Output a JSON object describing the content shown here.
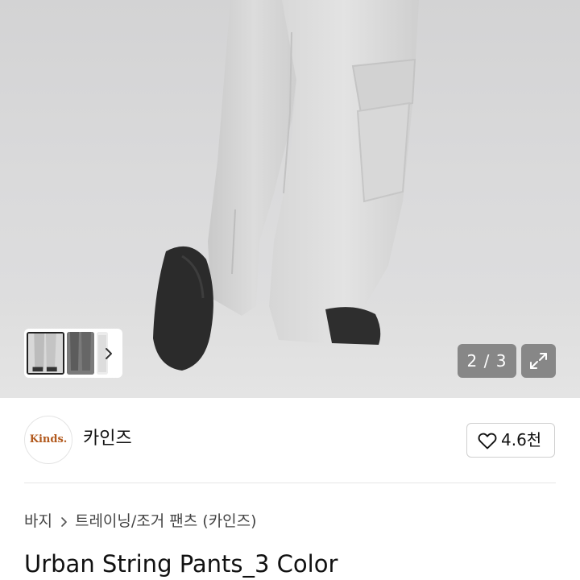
{
  "gallery": {
    "counter_current": "2",
    "counter_total": "3",
    "counter_separator": "/",
    "counter_text": "2 / 3",
    "thumbnails": [
      {
        "name": "thumb-1",
        "selected": true
      },
      {
        "name": "thumb-2",
        "selected": false
      },
      {
        "name": "thumb-3",
        "selected": false
      }
    ],
    "next_icon": "chevron-right-icon",
    "expand_icon": "expand-arrows-icon"
  },
  "seller": {
    "logo_text": "Kinds.",
    "name": "카인즈",
    "like_icon": "heart-outline-icon",
    "like_count": "4.6천"
  },
  "breadcrumb": {
    "items": [
      "바지",
      "트레이닝/조거 팬츠 (카인즈)"
    ],
    "separator_icon": "chevron-right-icon"
  },
  "product": {
    "title": "Urban String Pants_3 Color"
  },
  "colors": {
    "logo_text": "#b25a1e",
    "counter_bg": "#646464",
    "divider": "#e6e6e6"
  }
}
